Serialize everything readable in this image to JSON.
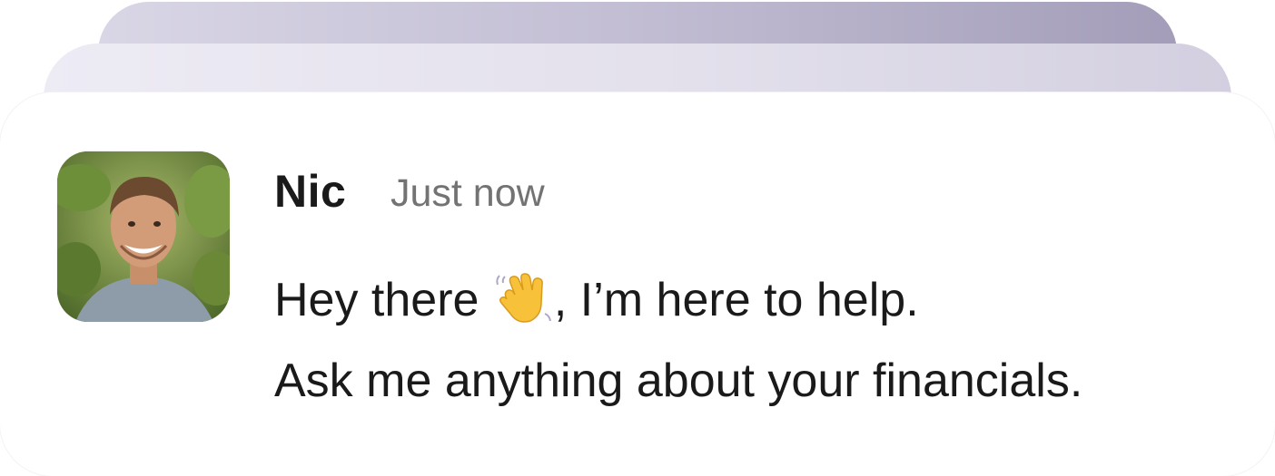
{
  "message": {
    "sender_name": "Nic",
    "timestamp": "Just now",
    "line1_before_icon": "Hey there ",
    "icon": "waving-hand-icon",
    "line1_after_icon": ", I’m here to help.",
    "line2": "Ask me anything about your financials."
  }
}
